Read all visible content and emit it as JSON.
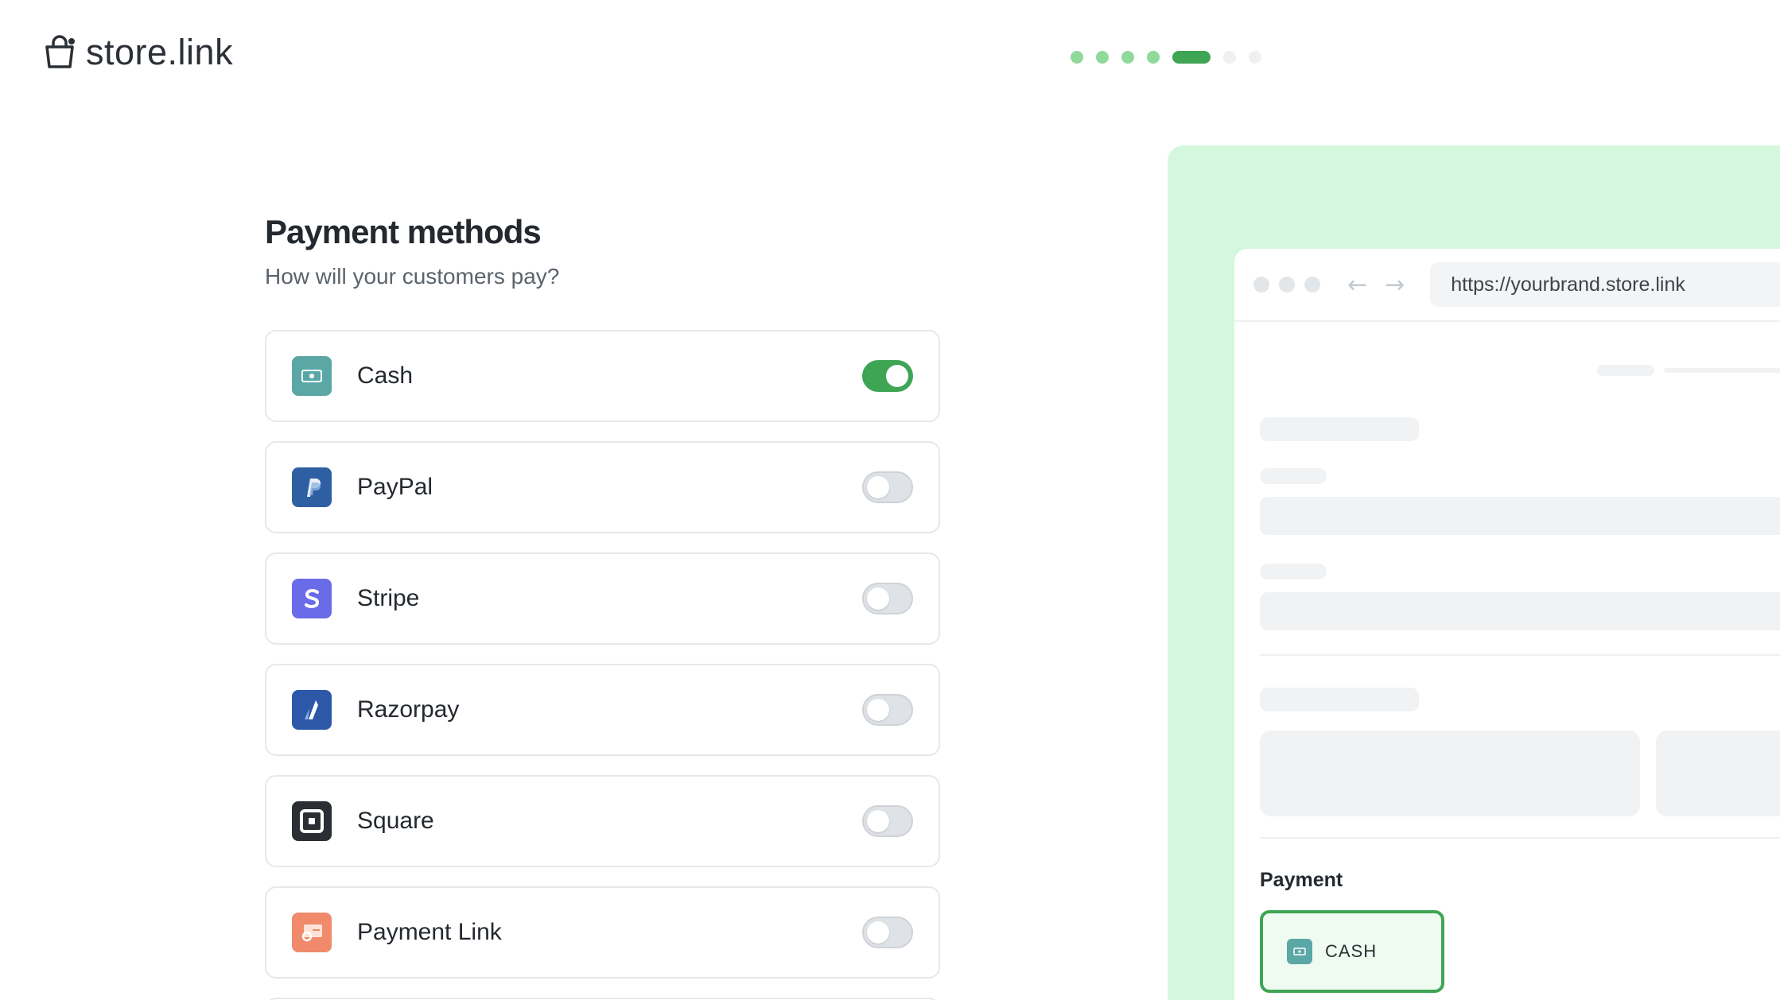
{
  "brand": {
    "name": "store.link",
    "icon": "shopping-bag-icon"
  },
  "progress": {
    "total_steps": 7,
    "current_step": 5
  },
  "heading": {
    "title": "Payment methods",
    "subtitle": "How will your customers pay?"
  },
  "methods": [
    {
      "label": "Cash",
      "icon": "cash-icon",
      "color": "#5aa7a6",
      "enabled": true
    },
    {
      "label": "PayPal",
      "icon": "paypal-icon",
      "color": "#2f5fa3",
      "enabled": false
    },
    {
      "label": "Stripe",
      "icon": "stripe-icon",
      "color": "#6a6be8",
      "enabled": false
    },
    {
      "label": "Razorpay",
      "icon": "razorpay-icon",
      "color": "#2d58a8",
      "enabled": false
    },
    {
      "label": "Square",
      "icon": "square-icon",
      "color": "#2b2f33",
      "enabled": false
    },
    {
      "label": "Payment Link",
      "icon": "payment-link-icon",
      "color": "#f08a6b",
      "enabled": false
    }
  ],
  "preview": {
    "url": "https://yourbrand.store.link",
    "payment_title": "Payment",
    "payment_chip": "CASH"
  },
  "colors": {
    "accent": "#3ea554",
    "preview_bg": "#d4f7dd"
  }
}
